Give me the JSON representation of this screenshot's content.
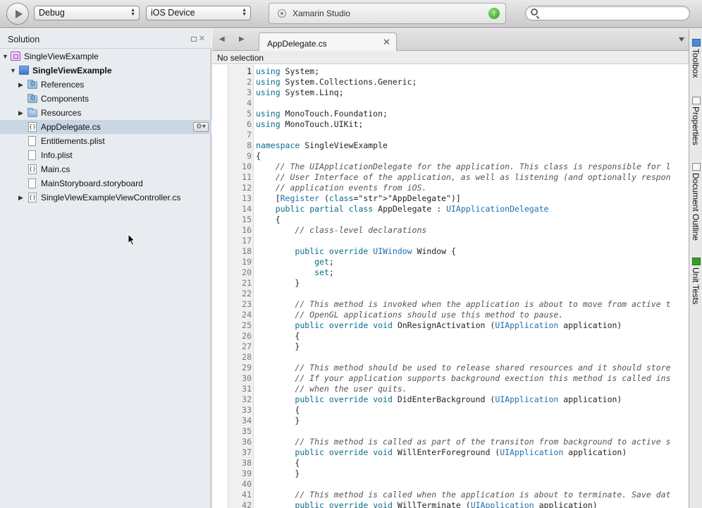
{
  "toolbar": {
    "run_tooltip": "Run",
    "configuration": "Debug",
    "device": "iOS Device",
    "status": "Xamarin Studio",
    "search_placeholder": ""
  },
  "solution": {
    "title": "Solution",
    "items": [
      {
        "label": "SingleViewExample",
        "kind": "solution",
        "expanded": true
      },
      {
        "label": "SingleViewExample",
        "kind": "project",
        "expanded": true
      },
      {
        "label": "References",
        "kind": "folder-gear",
        "expanded": false
      },
      {
        "label": "Components",
        "kind": "folder-gear",
        "expanded": false
      },
      {
        "label": "Resources",
        "kind": "folder",
        "expanded": false
      },
      {
        "label": "AppDelegate.cs",
        "kind": "cs",
        "selected": true
      },
      {
        "label": "Entitlements.plist",
        "kind": "file"
      },
      {
        "label": "Info.plist",
        "kind": "file"
      },
      {
        "label": "Main.cs",
        "kind": "cs"
      },
      {
        "label": "MainStoryboard.storyboard",
        "kind": "file"
      },
      {
        "label": "SingleViewExampleViewController.cs",
        "kind": "cs",
        "expanded": false
      }
    ]
  },
  "editor": {
    "tab_label": "AppDelegate.cs",
    "pathbar": "No selection",
    "current_line": 1,
    "lines": [
      "using System;",
      "using System.Collections.Generic;",
      "using System.Linq;",
      "",
      "using MonoTouch.Foundation;",
      "using MonoTouch.UIKit;",
      "",
      "namespace SingleViewExample",
      "{",
      "    // The UIApplicationDelegate for the application. This class is responsible for l",
      "    // User Interface of the application, as well as listening (and optionally respon",
      "    // application events from iOS.",
      "    [Register (\"AppDelegate\")]",
      "    public partial class AppDelegate : UIApplicationDelegate",
      "    {",
      "        // class-level declarations",
      "",
      "        public override UIWindow Window {",
      "            get;",
      "            set;",
      "        }",
      "",
      "        // This method is invoked when the application is about to move from active t",
      "        // OpenGL applications should use this method to pause.",
      "        public override void OnResignActivation (UIApplication application)",
      "        {",
      "        }",
      "",
      "        // This method should be used to release shared resources and it should store",
      "        // If your application supports background exection this method is called ins",
      "        // when the user quits.",
      "        public override void DidEnterBackground (UIApplication application)",
      "        {",
      "        }",
      "",
      "        // This method is called as part of the transiton from background to active s",
      "        public override void WillEnterForeground (UIApplication application)",
      "        {",
      "        }",
      "",
      "        // This method is called when the application is about to terminate. Save dat",
      "        public override void WillTerminate (UIApplication application)"
    ]
  },
  "dock": {
    "items": [
      "Toolbox",
      "Properties",
      "Document Outline",
      "Unit Tests"
    ]
  },
  "colors": {
    "keyword": "#0a6b8c",
    "type": "#1f6fb0",
    "string": "#c0392b",
    "comment": "#555555",
    "selection": "#c9d6e4"
  }
}
